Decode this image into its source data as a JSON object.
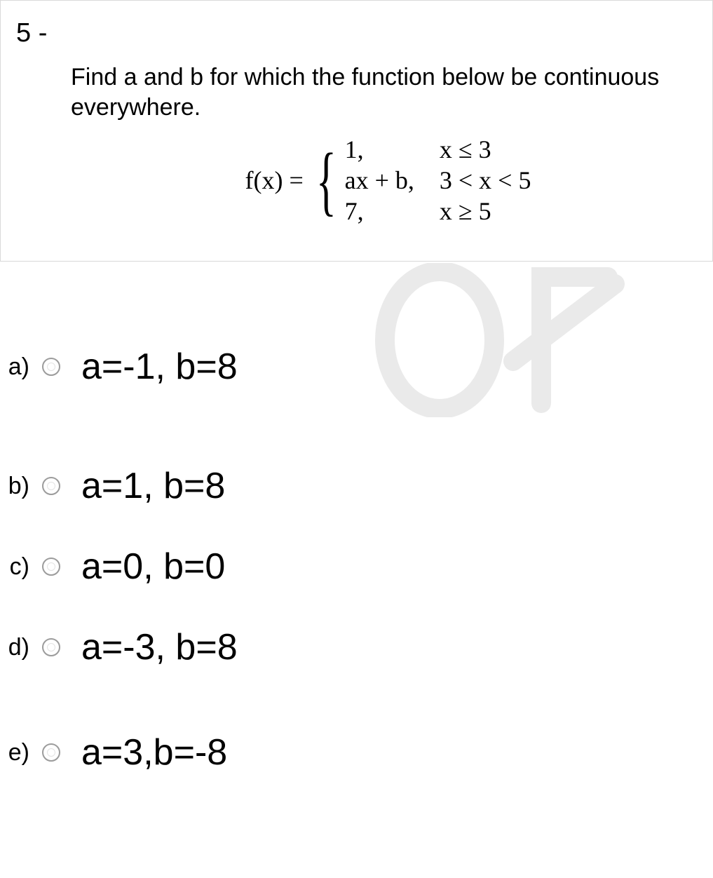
{
  "question": {
    "number": "5 -",
    "prompt": "Find a and b for which the function below be continuous everywhere.",
    "function_label": "f(x) =",
    "pieces": [
      {
        "expr": "1,",
        "cond": "x ≤ 3"
      },
      {
        "expr": "ax + b,",
        "cond": "3 < x < 5"
      },
      {
        "expr": "7,",
        "cond": "x ≥ 5"
      }
    ]
  },
  "choices": [
    {
      "letter": "a)",
      "text": "a=-1, b=8"
    },
    {
      "letter": "b)",
      "text": "a=1, b=8"
    },
    {
      "letter": "c)",
      "text": "a=0, b=0"
    },
    {
      "letter": "d)",
      "text": "a=-3, b=8"
    },
    {
      "letter": "e)",
      "text": "a=3,b=-8"
    }
  ]
}
